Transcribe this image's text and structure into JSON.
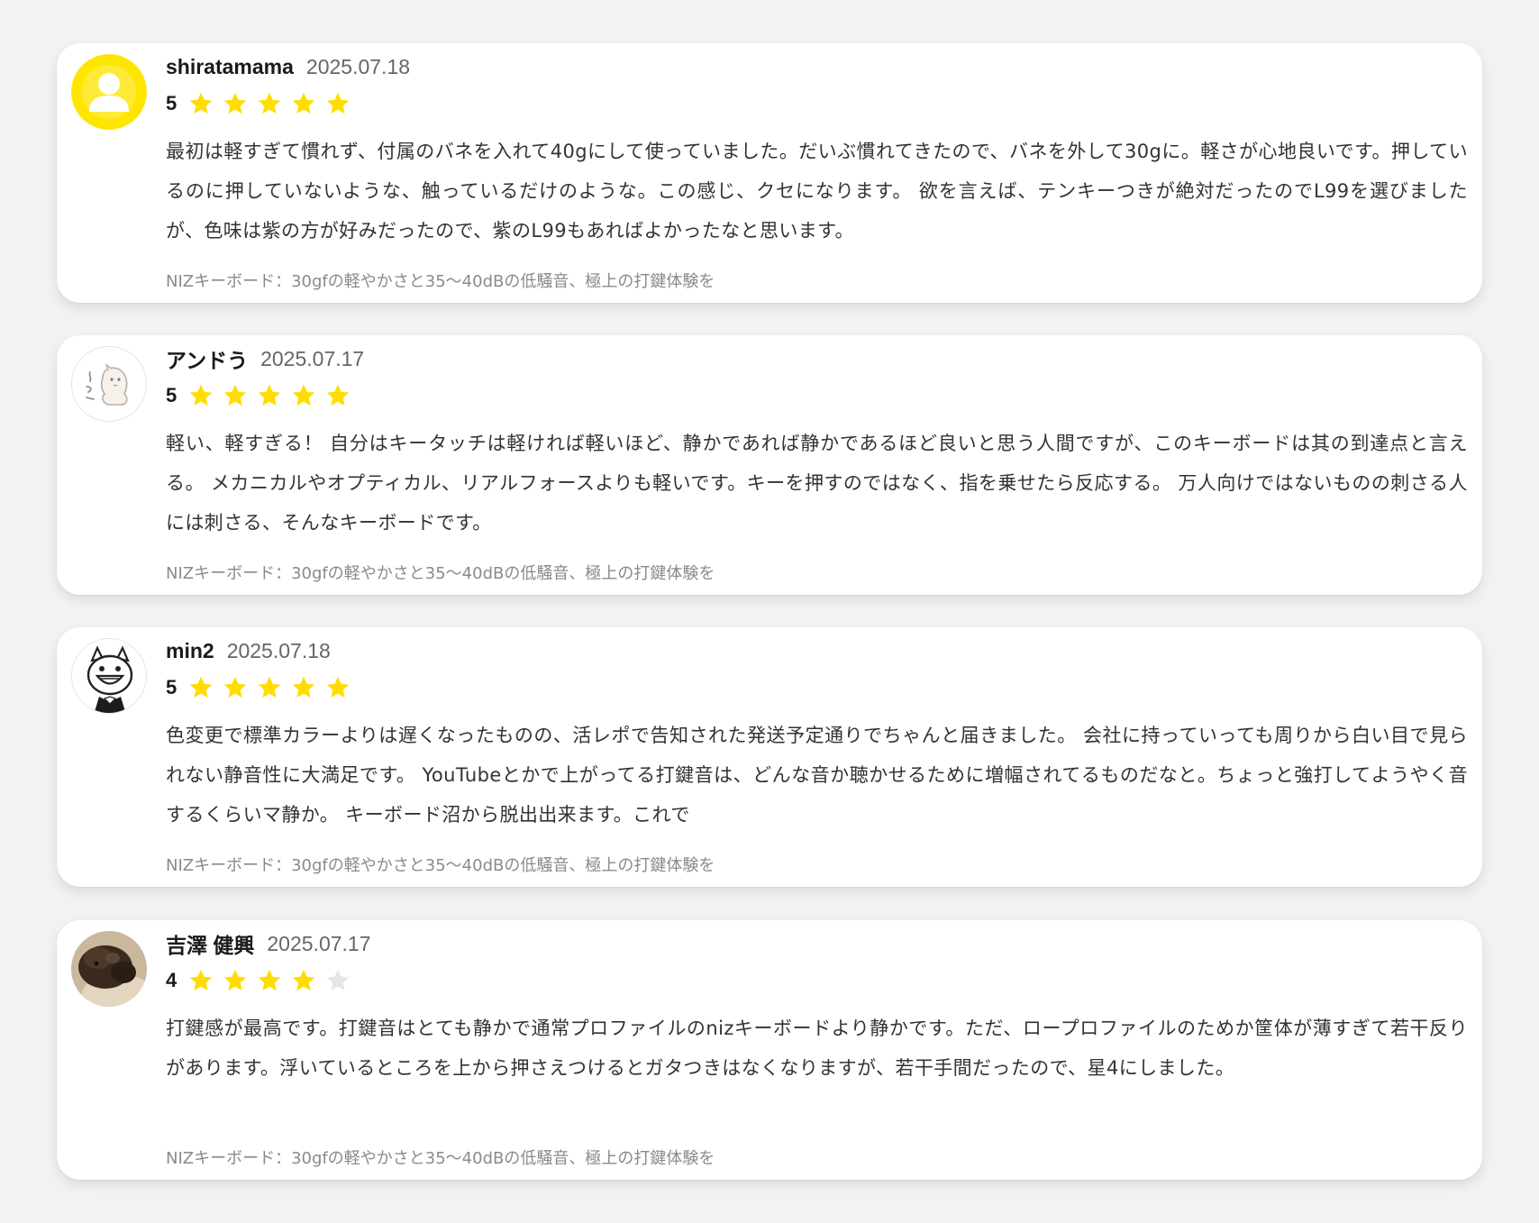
{
  "colors": {
    "background": "#f2f2f2",
    "card": "#ffffff",
    "star_filled": "#ffdd00",
    "star_empty": "#e6e6e6",
    "date": "#666666",
    "product_link": "#8a8a8a"
  },
  "reviews": [
    {
      "name": "shiratamama",
      "date": "2025.07.18",
      "rating": "5",
      "stars_filled": 5,
      "avatar": "default-user-avatar-icon",
      "text": "最初は軽すぎて慣れず、付属のバネを入れて40gにして使っていました。だいぶ慣れてきたので、バネを外して30gに。軽さが心地良いです。押しているのに押していないような、触っているだけのような。この感じ、クセになります。 欲を言えば、テンキーつきが絶対だったのでL99を選びましたが、色味は紫の方が好みだったので、紫のL99もあればよかったなと思います。",
      "product": "NIZキーボード：30gfの軽やかさと35～40dBの低騒音、極上の打鍵体験を"
    },
    {
      "name": "アンドう",
      "date": "2025.07.17",
      "rating": "5",
      "stars_filled": 5,
      "avatar": "sketch-animal-avatar-icon",
      "text": "軽い、軽すぎる！ 自分はキータッチは軽ければ軽いほど、静かであれば静かであるほど良いと思う人間ですが、このキーボードは其の到達点と言える。 メカニカルやオプティカル、リアルフォースよりも軽いです。キーを押すのではなく、指を乗せたら反応する。 万人向けではないものの刺さる人には刺さる、そんなキーボードです。",
      "product": "NIZキーボード：30gfの軽やかさと35～40dBの低騒音、極上の打鍵体験を"
    },
    {
      "name": "min2",
      "date": "2025.07.18",
      "rating": "5",
      "stars_filled": 5,
      "avatar": "smiling-character-avatar-icon",
      "text": "色変更で標準カラーよりは遅くなったものの、活レポで告知された発送予定通りでちゃんと届きました。 会社に持っていっても周りから白い目で見られない静音性に大満足です。 YouTubeとかで上がってる打鍵音は、どんな音か聴かせるために増幅されてるものだなと。ちょっと強打してようやく音するくらいマ静か。 キーボード沼から脱出出来ます。これで",
      "product": "NIZキーボード：30gfの軽やかさと35～40dBの低騒音、極上の打鍵体験を"
    },
    {
      "name": "吉澤 健興",
      "date": "2025.07.17",
      "rating": "4",
      "stars_filled": 4,
      "avatar": "pet-photo-avatar-icon",
      "text": "打鍵感が最高です。打鍵音はとても静かで通常プロファイルのnizキーボードより静かです。ただ、ロープロファイルのためか筐体が薄すぎて若干反りがあります。浮いているところを上から押さえつけるとガタつきはなくなりますが、若干手間だったので、星4にしました。",
      "product": "NIZキーボード：30gfの軽やかさと35～40dBの低騒音、極上の打鍵体験を"
    }
  ]
}
